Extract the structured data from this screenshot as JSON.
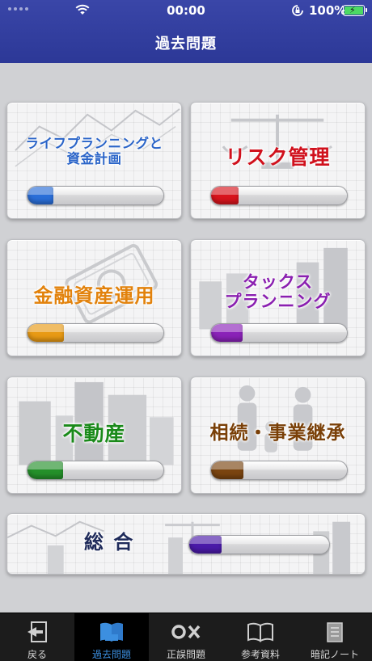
{
  "status_bar": {
    "time": "00:00",
    "battery": "100%"
  },
  "header": {
    "title": "過去問題"
  },
  "categories": [
    {
      "label_line1": "ライフプランニングと",
      "label_line2": "資金計画",
      "color": "#2a64c8",
      "bar_color": "#2a6ed8",
      "progress": 0.19
    },
    {
      "label_line1": "リスク管理",
      "label_line2": "",
      "color": "#d0101c",
      "bar_color": "#d8141c",
      "progress": 0.2
    },
    {
      "label_line1": "金融資産運用",
      "label_line2": "",
      "color": "#e2820c",
      "bar_color": "#e89a14",
      "progress": 0.27
    },
    {
      "label_line1": "タックス",
      "label_line2": "プランニング",
      "color": "#8a1fb0",
      "bar_color": "#8a22b8",
      "progress": 0.23
    },
    {
      "label_line1": "不動産",
      "label_line2": "",
      "color": "#1a8a1a",
      "bar_color": "#24902a",
      "progress": 0.26
    },
    {
      "label_line1": "相続・事業継承",
      "label_line2": "",
      "color": "#7a4008",
      "bar_color": "#7a4410",
      "progress": 0.24
    }
  ],
  "overall": {
    "label": "総 合",
    "color": "#1e2a5a",
    "bar_color": "#4a1aa8",
    "progress": 0.23
  },
  "tabs": [
    {
      "label": "戻る",
      "icon": "back-icon",
      "active": false
    },
    {
      "label": "過去問題",
      "icon": "book-icon",
      "active": true
    },
    {
      "label": "正誤問題",
      "icon": "true-false-icon",
      "active": false
    },
    {
      "label": "参考資料",
      "icon": "open-book-icon",
      "active": false
    },
    {
      "label": "暗記ノート",
      "icon": "notebook-icon",
      "active": false
    }
  ]
}
